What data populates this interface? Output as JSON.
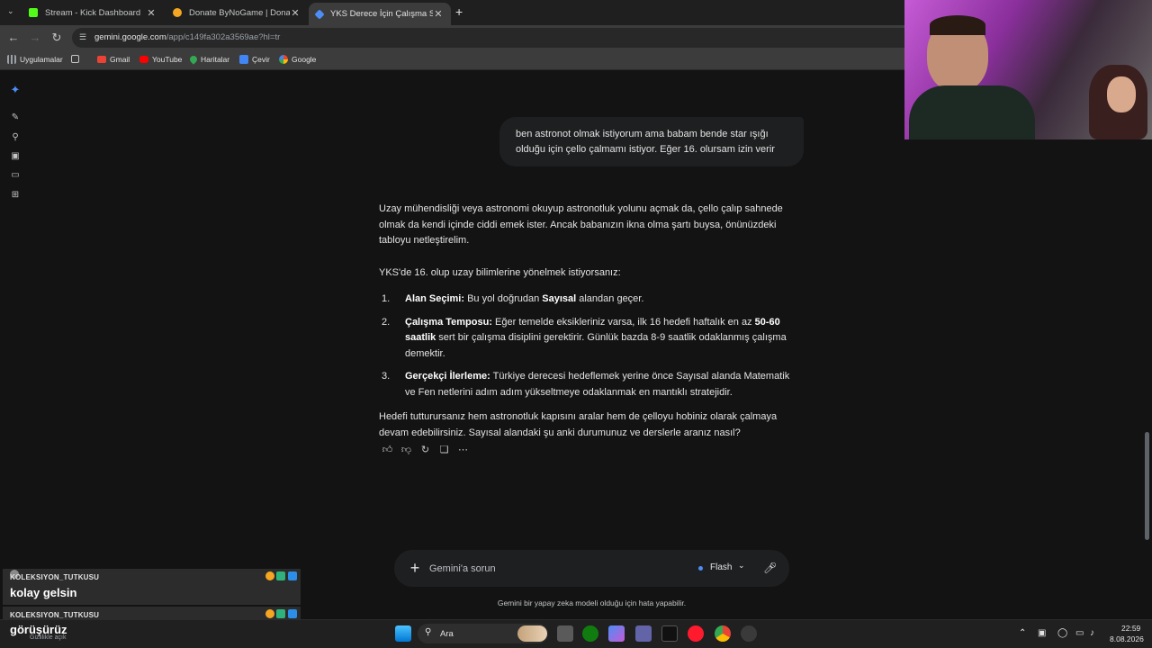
{
  "browser": {
    "tabs": [
      {
        "title": "Stream - Kick Dashboard",
        "color": "#53fc18",
        "active": false
      },
      {
        "title": "Donate ByNoGame | Donations",
        "color": "#f5a623",
        "active": false
      },
      {
        "title": "YKS Derece İçin Çalışma Saati",
        "color": "#4c8df6",
        "active": true
      }
    ],
    "new_tab": "+",
    "url_host": "gemini.google.com",
    "url_path": "/app/c149fa302a3569ae?hl=tr",
    "bookmarks": [
      {
        "label": "Uygulamalar",
        "color": "#9aa0a6"
      },
      {
        "label": "Gmail",
        "color": "#ea4335"
      },
      {
        "label": "YouTube",
        "color": "#ff0000"
      },
      {
        "label": "Haritalar",
        "color": "#34a853"
      },
      {
        "label": "Çevir",
        "color": "#4285f4"
      },
      {
        "label": "Google",
        "color": "#ffffff"
      }
    ]
  },
  "chat": {
    "user_message": "ben astronot olmak istiyorum ama babam bende star ışığı olduğu için çello çalmamı istiyor. Eğer 16. olursam izin verir",
    "response": {
      "intro": "Uzay mühendisliği veya astronomi okuyup astronotluk yolunu açmak da, çello çalıp sahnede olmak da kendi içinde ciddi emek ister. Ancak babanızın ikna olma şartı buysa, önünüzdeki tabloyu netleştirelim.",
      "lead": "YKS'de 16. olup uzay bilimlerine yönelmek istiyorsanız:",
      "items": [
        {
          "num": "1.",
          "title": "Alan Seçimi:",
          "text_a": " Bu yol doğrudan ",
          "bold": "Sayısal",
          "text_b": " alandan geçer."
        },
        {
          "num": "2.",
          "title": "Çalışma Temposu:",
          "text_a": " Eğer temelde eksikleriniz varsa, ilk 16 hedefi haftalık en az ",
          "bold": "50-60 saatlik",
          "text_b": " sert bir çalışma disiplini gerektirir. Günlük bazda 8-9 saatlik odaklanmış çalışma demektir."
        },
        {
          "num": "3.",
          "title": "Gerçekçi İlerleme:",
          "text_a": " Türkiye derecesi hedeflemek yerine önce Sayısal alanda Matematik ve Fen netlerini adım adım yükseltmeye odaklanmak en mantıklı stratejidir.",
          "bold": "",
          "text_b": ""
        }
      ],
      "outro": "Hedefi tutturursanız hem astronotluk kapısını aralar hem de çelloyu hobiniz olarak çalmaya devam edebilirsiniz. Sayısal alandaki şu anki durumunuz ve derslerle aranız nasıl?"
    },
    "prompt_placeholder": "Gemini'a sorun",
    "model": "Flash",
    "disclaimer": "Gemini bir yapay zeka modeli olduğu için hata yapabilir."
  },
  "stream_chat": [
    {
      "user": "KOLEKSIYON_TUTKUSU",
      "message": "kolay gelsin"
    },
    {
      "user": "KOLEKSIYON_TUTKUSU",
      "message": "görüşürüz"
    }
  ],
  "stream_status": "Gizlilikle açık",
  "taskbar": {
    "search_label": "Ara",
    "time": "22:59",
    "date": "8.08.2026"
  }
}
